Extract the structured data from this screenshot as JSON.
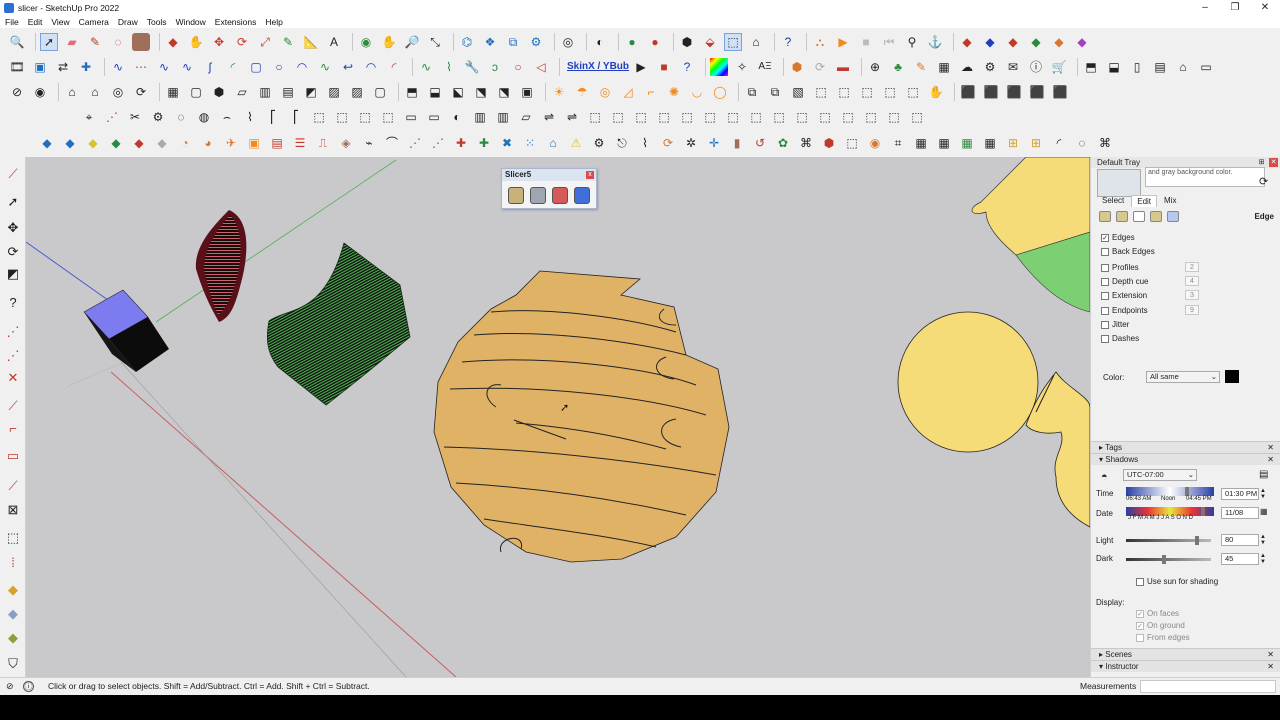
{
  "window": {
    "title": "slicer - SketchUp Pro 2022",
    "buttons": [
      "–",
      "❐",
      "✕"
    ]
  },
  "menu": [
    "File",
    "Edit",
    "View",
    "Camera",
    "Draw",
    "Tools",
    "Window",
    "Extensions",
    "Help"
  ],
  "toolbar": {
    "skinx_label": "SkinX / YBub"
  },
  "slicer_toolbar": {
    "title": "Slicer5",
    "close": "x"
  },
  "tray": {
    "title": "Default Tray",
    "thumb_text": "and gray background color.",
    "tabs": [
      "Select",
      "Edit",
      "Mix"
    ],
    "section_label": "Edge",
    "edge_options": [
      {
        "label": "Edges",
        "checked": true,
        "value": ""
      },
      {
        "label": "Back Edges",
        "checked": false,
        "value": ""
      },
      {
        "label": "Profiles",
        "checked": false,
        "value": "2"
      },
      {
        "label": "Depth cue",
        "checked": false,
        "value": "4"
      },
      {
        "label": "Extension",
        "checked": false,
        "value": "3"
      },
      {
        "label": "Endpoints",
        "checked": false,
        "value": "9"
      },
      {
        "label": "Jitter",
        "checked": false,
        "value": ""
      },
      {
        "label": "Dashes",
        "checked": false,
        "value": ""
      }
    ],
    "color_label": "Color:",
    "color_value": "All same",
    "color_swatch": "#000000",
    "panels": {
      "tags": "Tags",
      "shadows": "Shadows",
      "scenes": "Scenes",
      "instructor": "Instructor"
    },
    "shadows": {
      "timezone": "UTC-07:00",
      "time_label": "Time",
      "time_start": "06:43 AM",
      "time_noon": "Noon",
      "time_end": "04:45 PM",
      "time_value": "01:30 PM",
      "date_label": "Date",
      "months": "J F M A M J J A S O N D",
      "date_value": "11/08",
      "light_label": "Light",
      "light_value": "80",
      "dark_label": "Dark",
      "dark_value": "45",
      "sun_shading": "Use sun for shading",
      "display_label": "Display:",
      "on_faces": "On faces",
      "on_ground": "On ground",
      "from_edges": "From edges"
    }
  },
  "status": {
    "message": "Click or drag to select objects. Shift = Add/Subtract. Ctrl = Add. Shift + Ctrl = Subtract.",
    "measurements_label": "Measurements"
  },
  "colors": {
    "viewport_bg": "#c9c9cc",
    "sphere_fill": "#e0b266",
    "yellow_shape": "#f5dc78",
    "wave_green": "#5fbf62",
    "cube_top": "#7d7bf0"
  }
}
